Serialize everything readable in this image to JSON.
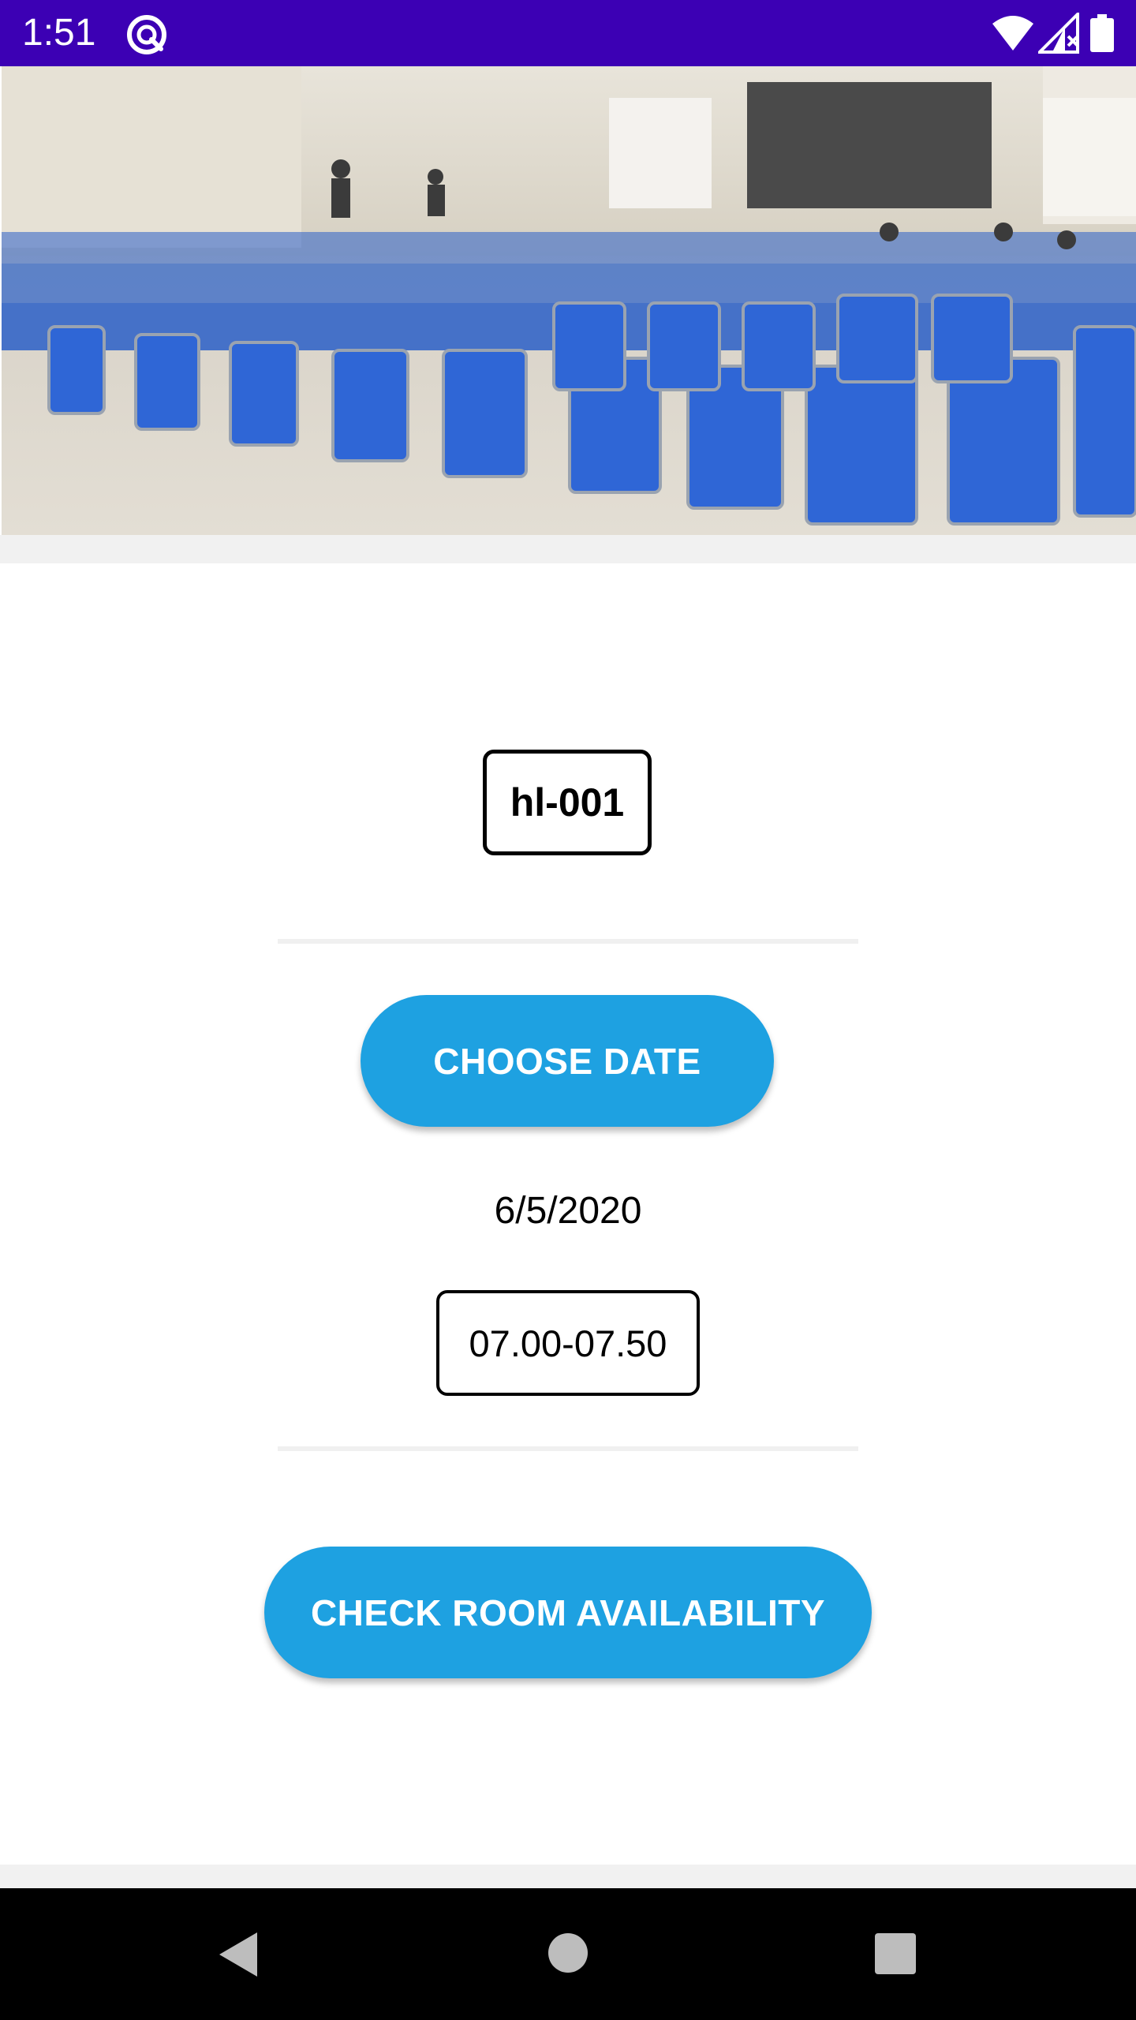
{
  "status_bar": {
    "time": "1:51",
    "background": "#3c00b4",
    "icons": [
      "app-notification-icon",
      "wifi-icon",
      "cell-signal-icon",
      "battery-icon"
    ]
  },
  "hero": {
    "image_description_icon": "auditorium-photo",
    "accent_chair_color": "#2a5fc8"
  },
  "room": {
    "code": "hl-001"
  },
  "date_picker": {
    "button_label": "CHOOSE DATE",
    "selected_date": "6/5/2020"
  },
  "time_slot": {
    "value": "07.00-07.50"
  },
  "actions": {
    "check_label": "CHECK ROOM AVAILABILITY"
  },
  "colors": {
    "button": "#1ea1e1",
    "divider": "#f0f0f0"
  },
  "nav_bar": {
    "icons": [
      "back-icon",
      "home-icon",
      "recents-icon"
    ]
  }
}
